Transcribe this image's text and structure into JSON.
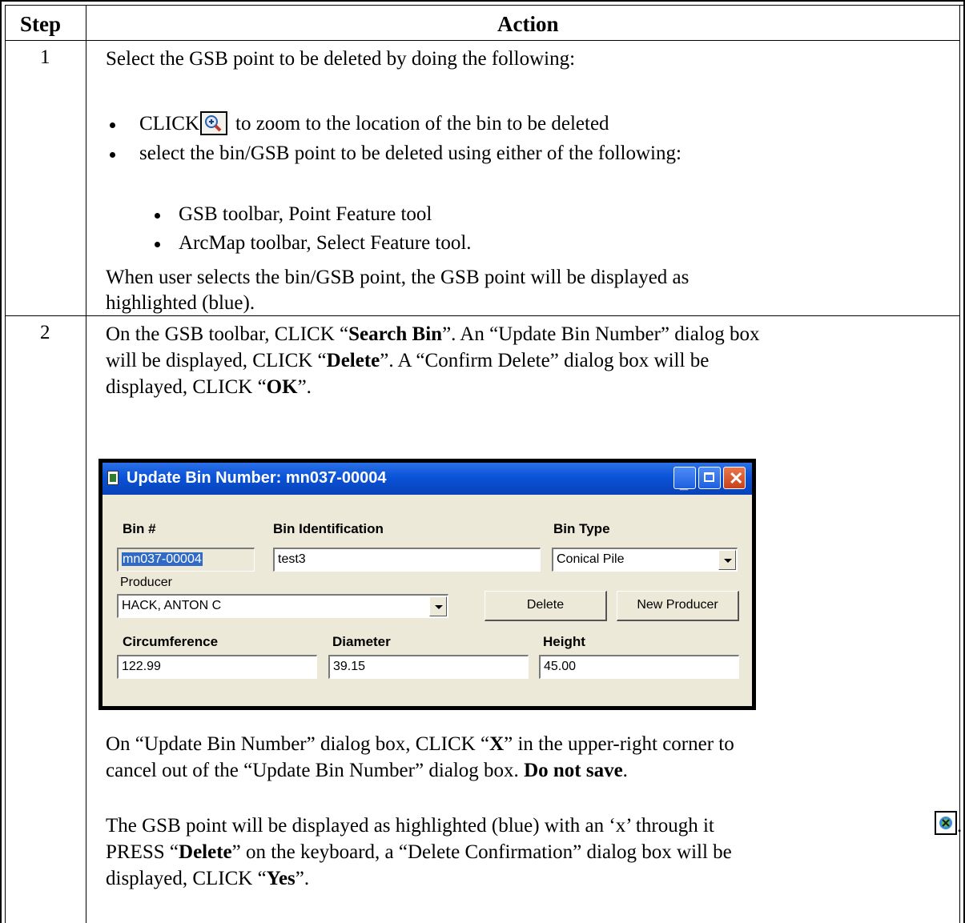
{
  "table": {
    "header_step": "Step",
    "header_action": "Action"
  },
  "row1": {
    "step": "1",
    "intro": "Select the GSB point to be deleted by doing the following:",
    "bullet1_pre": "CLICK",
    "bullet1_post": "to zoom to the location of the bin to be deleted",
    "bullet2": "select the bin/GSB point to be deleted using either of the following:",
    "sub1": "GSB toolbar, Point Feature tool",
    "sub2": "ArcMap toolbar, Select Feature tool.",
    "note_line1": "When user selects the bin/GSB point, the GSB point will be displayed as",
    "note_line2": "highlighted (blue)."
  },
  "row2": {
    "step": "2",
    "p1_a": "On the GSB toolbar, CLICK “",
    "p1_b": "Search Bin",
    "p1_c": "”.  An “Update Bin Number” dialog box",
    "p1_line2_a": "will be displayed, CLICK “",
    "p1_line2_b": "Delete",
    "p1_line2_c": "”.  A “Confirm Delete” dialog box will be",
    "p1_line3_a": "displayed, CLICK “",
    "p1_line3_b": "OK",
    "p1_line3_c": "”.",
    "p2_line1_a": "On “Update Bin Number” dialog box, CLICK “",
    "p2_line1_b": "X",
    "p2_line1_c": "” in the upper-right corner to",
    "p2_line2_a": "cancel out of the “Update Bin Number” dialog box.  ",
    "p2_line2_b": "Do not save",
    "p2_line2_c": ".",
    "p3_line1_a": "The GSB point will be displayed as highlighted (blue) with an ‘x’ through it",
    "p3_line1_c": ".",
    "p3_line2_a": "PRESS “",
    "p3_line2_b": "Delete",
    "p3_line2_c": "” on the keyboard, a “Delete Confirmation” dialog box will be",
    "p3_line3_a": "displayed, CLICK “",
    "p3_line3_b": "Yes",
    "p3_line3_c": "”."
  },
  "dialog": {
    "title": "Update Bin Number: mn037-00004",
    "bin_label": "Bin #",
    "bin_value": "mn037-00004",
    "ident_label": "Bin Identification",
    "ident_value": "test3",
    "type_label": "Bin Type",
    "type_value": "Conical Pile",
    "producer_label": "Producer",
    "producer_value": "HACK, ANTON C",
    "delete_button": "Delete",
    "new_producer_button": "New Producer",
    "circ_label": "Circumference",
    "circ_value": "122.99",
    "diam_label": "Diameter",
    "diam_value": "39.15",
    "height_label": "Height",
    "height_value": "45.00"
  },
  "icons": {
    "zoom": "zoom-in-icon",
    "gsb_point": "gsb-point-x-icon",
    "titlebar_colors": [
      "#2b71e6",
      "#0a52d8"
    ]
  }
}
